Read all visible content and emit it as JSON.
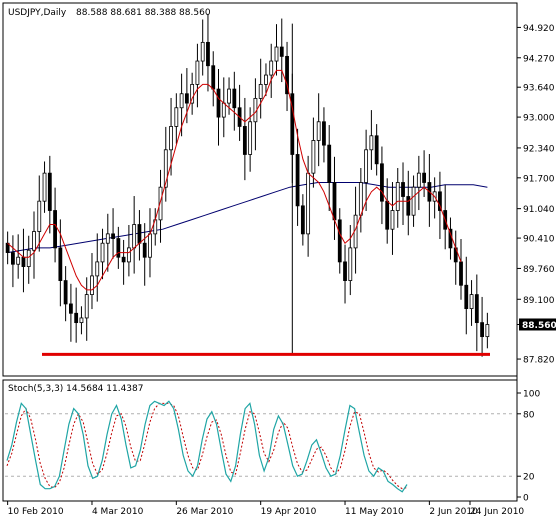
{
  "header": {
    "symbol_timeframe": "USDJPY,Daily",
    "ohlc": "88.588 88.681 88.388 88.560"
  },
  "colors": {
    "background": "#ffffff",
    "border": "#000000",
    "candle": "#000000",
    "ma_fast": "#d00000",
    "ma_slow": "#00006e",
    "support_line": "#e00000",
    "stoch_main": "#1fa5a5",
    "stoch_signal": "#c00000",
    "level_line": "#b0b0b0"
  },
  "chart_data": [
    {
      "type": "candlestick",
      "title": "USDJPY,Daily",
      "ylim": [
        87.5,
        95.4
      ],
      "y_ticks": [
        "94.920",
        "94.270",
        "93.640",
        "93.000",
        "92.340",
        "91.700",
        "91.040",
        "90.410",
        "89.760",
        "89.100",
        "88.560",
        "87.820"
      ],
      "y_tick_values": [
        94.92,
        94.27,
        93.64,
        93.0,
        92.34,
        91.7,
        91.04,
        90.41,
        89.76,
        89.1,
        88.56,
        87.82
      ],
      "x_tick_labels": [
        "10 Feb 2010",
        "4 Mar 2010",
        "26 Mar 2010",
        "19 Apr 2010",
        "11 May 2010",
        "2 Jun 2010",
        "24 Jun 2010"
      ],
      "x_tick_index": [
        0,
        16,
        32,
        48,
        64,
        80,
        96
      ],
      "last_price": "88.560",
      "support_level": 87.92,
      "candles_close": [
        90.1,
        89.85,
        90.0,
        89.8,
        90.15,
        90.55,
        91.2,
        91.8,
        91.0,
        90.2,
        89.5,
        89.0,
        88.8,
        88.6,
        88.7,
        89.2,
        89.6,
        89.9,
        90.3,
        90.5,
        90.4,
        90.0,
        89.9,
        90.2,
        90.7,
        90.3,
        90.0,
        90.5,
        90.8,
        91.5,
        92.3,
        92.8,
        93.2,
        93.5,
        93.3,
        93.7,
        94.2,
        94.6,
        94.1,
        93.6,
        93.0,
        93.3,
        93.6,
        93.2,
        92.8,
        92.2,
        92.9,
        93.4,
        93.7,
        93.9,
        94.2,
        94.5,
        94.3,
        93.5,
        92.2,
        91.1,
        90.5,
        91.8,
        92.5,
        92.9,
        92.4,
        91.6,
        90.8,
        89.9,
        89.5,
        90.2,
        90.9,
        91.6,
        92.3,
        92.6,
        92.0,
        91.2,
        90.6,
        91.0,
        91.6,
        91.3,
        90.9,
        91.5,
        91.8,
        91.6,
        91.2,
        91.4,
        91.0,
        90.6,
        90.2,
        89.9,
        89.4,
        88.9,
        89.2,
        88.6,
        88.3,
        88.56
      ],
      "ma_fast": {
        "period_label": "",
        "values": [
          90.3,
          90.2,
          90.1,
          90.0,
          90.0,
          90.1,
          90.3,
          90.5,
          90.7,
          90.7,
          90.5,
          90.2,
          89.9,
          89.6,
          89.4,
          89.3,
          89.3,
          89.4,
          89.6,
          89.8,
          90.0,
          90.1,
          90.1,
          90.1,
          90.2,
          90.3,
          90.4,
          90.5,
          90.8,
          91.2,
          91.6,
          92.0,
          92.4,
          92.8,
          93.1,
          93.4,
          93.6,
          93.7,
          93.7,
          93.6,
          93.4,
          93.3,
          93.2,
          93.1,
          93.0,
          92.9,
          93.0,
          93.1,
          93.3,
          93.5,
          93.8,
          94.0,
          94.0,
          93.7,
          93.2,
          92.6,
          92.1,
          91.8,
          91.7,
          91.6,
          91.4,
          91.1,
          90.8,
          90.5,
          90.3,
          90.4,
          90.6,
          90.9,
          91.2,
          91.4,
          91.5,
          91.4,
          91.2,
          91.1,
          91.2,
          91.2,
          91.2,
          91.3,
          91.4,
          91.5,
          91.4,
          91.3,
          91.1,
          90.8,
          90.5,
          90.2,
          89.9
        ]
      },
      "ma_slow": {
        "period_label": "",
        "values": [
          90.1,
          90.15,
          90.2,
          90.2,
          90.25,
          90.3,
          90.35,
          90.4,
          90.45,
          90.5,
          90.55,
          90.6,
          90.7,
          90.8,
          90.9,
          91.0,
          91.1,
          91.2,
          91.3,
          91.4,
          91.5,
          91.55,
          91.6,
          91.6,
          91.6,
          91.6,
          91.55,
          91.5,
          91.5,
          91.5,
          91.5,
          91.55,
          91.55,
          91.55,
          91.5
        ]
      }
    },
    {
      "type": "line",
      "title": "Stoch(5,3,3) 14.5684 11.4387",
      "indicator_label": "Stoch(5,3,3)",
      "main_value": "14.5684",
      "signal_value": "11.4387",
      "ylim": [
        0,
        100
      ],
      "y_ticks": [
        "100",
        "80",
        "20",
        "0"
      ],
      "levels": [
        80,
        20
      ],
      "series": [
        {
          "name": "",
          "values": [
            35,
            50,
            72,
            90,
            85,
            60,
            35,
            12,
            8,
            8,
            10,
            20,
            45,
            70,
            85,
            80,
            60,
            30,
            18,
            20,
            35,
            60,
            80,
            88,
            75,
            50,
            28,
            30,
            45,
            70,
            88,
            92,
            90,
            88,
            92,
            85,
            65,
            40,
            25,
            20,
            30,
            55,
            75,
            82,
            70,
            45,
            22,
            15,
            30,
            60,
            85,
            90,
            70,
            40,
            25,
            38,
            65,
            78,
            70,
            50,
            30,
            20,
            22,
            35,
            50,
            55,
            42,
            28,
            20,
            22,
            40,
            65,
            88,
            85,
            62,
            40,
            25,
            20,
            28,
            25,
            15,
            12,
            8,
            5,
            12
          ]
        },
        {
          "name": "",
          "values": [
            30,
            42,
            60,
            78,
            85,
            75,
            55,
            32,
            18,
            10,
            9,
            14,
            28,
            50,
            70,
            80,
            72,
            52,
            32,
            22,
            26,
            42,
            62,
            78,
            80,
            68,
            48,
            34,
            35,
            52,
            72,
            85,
            90,
            90,
            90,
            88,
            78,
            58,
            40,
            28,
            26,
            40,
            58,
            72,
            74,
            60,
            40,
            24,
            22,
            42,
            65,
            82,
            80,
            62,
            42,
            34,
            45,
            62,
            72,
            66,
            48,
            32,
            24,
            26,
            36,
            46,
            48,
            40,
            28,
            22,
            28,
            45,
            68,
            82,
            80,
            62,
            42,
            28,
            24,
            26,
            22,
            16,
            11,
            8,
            9
          ]
        }
      ]
    }
  ]
}
